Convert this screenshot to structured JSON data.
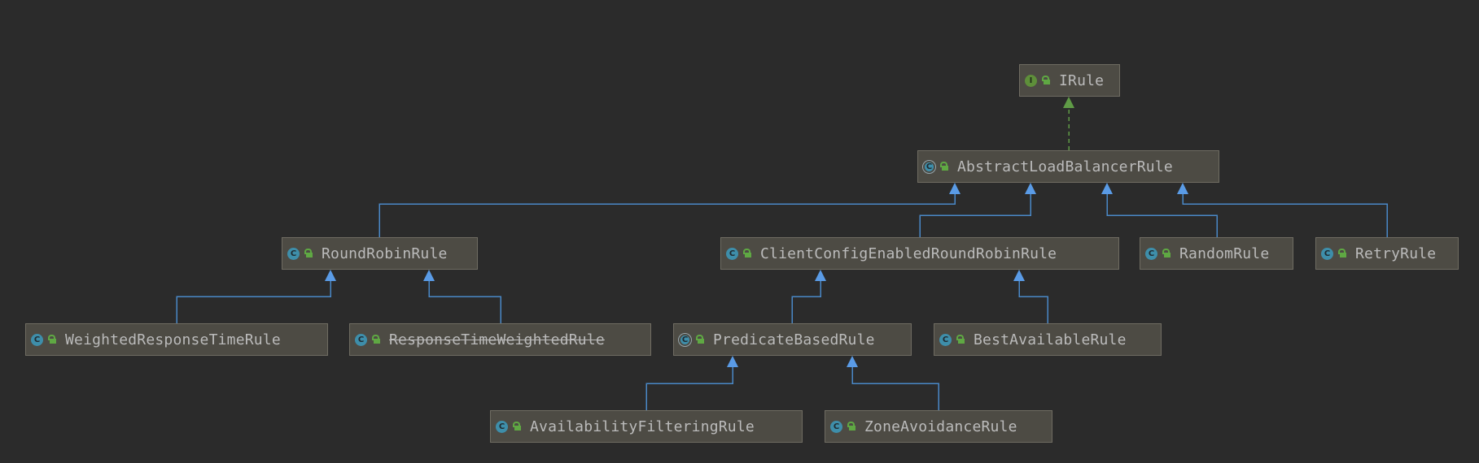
{
  "diagram": {
    "nodes": [
      {
        "id": "irule",
        "label": "IRule",
        "kind": "interface",
        "deprecated": false
      },
      {
        "id": "abstract",
        "label": "AbstractLoadBalancerRule",
        "kind": "abstract",
        "deprecated": false
      },
      {
        "id": "roundrobin",
        "label": "RoundRobinRule",
        "kind": "class",
        "deprecated": false
      },
      {
        "id": "clientconfig",
        "label": "ClientConfigEnabledRoundRobinRule",
        "kind": "class",
        "deprecated": false
      },
      {
        "id": "random",
        "label": "RandomRule",
        "kind": "class",
        "deprecated": false
      },
      {
        "id": "retry",
        "label": "RetryRule",
        "kind": "class",
        "deprecated": false
      },
      {
        "id": "weightedresponse",
        "label": "WeightedResponseTimeRule",
        "kind": "class",
        "deprecated": false
      },
      {
        "id": "responsetime",
        "label": "ResponseTimeWeightedRule",
        "kind": "class",
        "deprecated": true
      },
      {
        "id": "predicate",
        "label": "PredicateBasedRule",
        "kind": "abstract",
        "deprecated": false
      },
      {
        "id": "bestavailable",
        "label": "BestAvailableRule",
        "kind": "class",
        "deprecated": false
      },
      {
        "id": "availability",
        "label": "AvailabilityFilteringRule",
        "kind": "class",
        "deprecated": false
      },
      {
        "id": "zoneavoidance",
        "label": "ZoneAvoidanceRule",
        "kind": "class",
        "deprecated": false
      }
    ],
    "edges": [
      {
        "from": "abstract",
        "to": "irule",
        "type": "implements"
      },
      {
        "from": "roundrobin",
        "to": "abstract",
        "type": "extends"
      },
      {
        "from": "clientconfig",
        "to": "abstract",
        "type": "extends"
      },
      {
        "from": "random",
        "to": "abstract",
        "type": "extends"
      },
      {
        "from": "retry",
        "to": "abstract",
        "type": "extends"
      },
      {
        "from": "weightedresponse",
        "to": "roundrobin",
        "type": "extends"
      },
      {
        "from": "responsetime",
        "to": "roundrobin",
        "type": "extends"
      },
      {
        "from": "predicate",
        "to": "clientconfig",
        "type": "extends"
      },
      {
        "from": "bestavailable",
        "to": "clientconfig",
        "type": "extends"
      },
      {
        "from": "availability",
        "to": "predicate",
        "type": "extends"
      },
      {
        "from": "zoneavoidance",
        "to": "predicate",
        "type": "extends"
      }
    ],
    "colors": {
      "background": "#2b2b2b",
      "node_fill": "#4d4b44",
      "node_border": "#6f6c62",
      "extends_line": "#4a88c7",
      "extends_arrow": "#5a9be6",
      "implements_line": "#5f9b46",
      "text": "#bbbbbb"
    },
    "icons": {
      "class": "class-icon",
      "abstract": "abstract-class-icon",
      "interface": "interface-icon",
      "visibility": "public-lock-icon"
    },
    "kind_letters": {
      "class": "C",
      "abstract": "C",
      "interface": "I"
    }
  }
}
